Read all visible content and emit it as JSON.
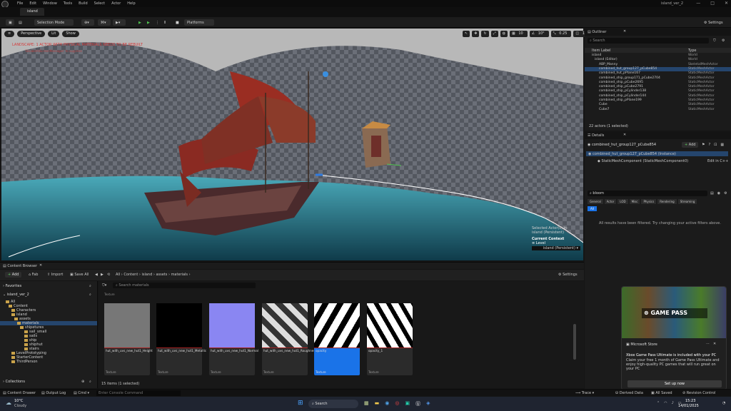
{
  "titlebar": {
    "menus": [
      "File",
      "Edit",
      "Window",
      "Tools",
      "Build",
      "Select",
      "Actor",
      "Help"
    ],
    "window_title": "island_ver_2",
    "controls": [
      "—",
      "□",
      "✕"
    ]
  },
  "tab": {
    "label": "island"
  },
  "toolbar": {
    "selection_mode": "Selection Mode",
    "platforms": "Platforms",
    "settings": "Settings"
  },
  "viewport": {
    "perspective": "Perspective",
    "lit": "Lit",
    "show": "Show",
    "warning": "LANDSCAPE: 1 ACTOR WITH PHYSICAL MATERIALS NEEDS TO BE REBUILT",
    "warning2": "'DisableAllScreenMessages' to suppress",
    "right_vals": [
      "10",
      "10°",
      "0.25",
      "1"
    ],
    "selected_actors": "Selected Actor(s) in:",
    "level_name": "island (Persistent)",
    "current_context": "Current Context",
    "level_label": "Level",
    "level_value": "island (Persistent)"
  },
  "content_browser": {
    "title": "Content Browser",
    "add": "Add",
    "fab": "Fab",
    "import": "Import",
    "save_all": "Save All",
    "breadcrumb": [
      "All",
      "Content",
      "island",
      "assets",
      "materials"
    ],
    "settings": "Settings",
    "favorites": "Favorites",
    "project": "island_ver_2",
    "search_placeholder": "Search materials",
    "collections": "Collections",
    "count": "15 items (1 selected)",
    "header_type": "Texture",
    "tree": [
      "All",
      "Content",
      "Characters",
      "island",
      "assets",
      "materials",
      "shipetures",
      "sail_small",
      "sails",
      "ship",
      "shiphut",
      "stairs",
      "LevelPrototyping",
      "StarterContent",
      "ThirdPerson"
    ],
    "assets": [
      {
        "name": "hut_with_uvs_new_hut1_Height",
        "type": "Texture"
      },
      {
        "name": "hut_with_uvs_new_hut1_Metallic",
        "type": "Texture"
      },
      {
        "name": "hut_with_uvs_new_hut1_Normal",
        "type": "Texture"
      },
      {
        "name": "hut_with_uvs_new_hut1_Roughness",
        "type": "Texture"
      },
      {
        "name": "opacity",
        "type": "Texture"
      },
      {
        "name": "opacity_1",
        "type": "Texture"
      }
    ]
  },
  "bottom": {
    "content_drawer": "Content Drawer",
    "output_log": "Output Log",
    "cmd": "Cmd",
    "console_placeholder": "Enter Console Command",
    "trace": "Trace",
    "derived_data": "Derived Data",
    "all_saved": "All Saved",
    "revision_control": "Revision Control"
  },
  "outliner": {
    "title": "Outliner",
    "search_placeholder": "Search",
    "col_label": "Item Label",
    "col_type": "Type",
    "summary": "22 actors (1 selected)",
    "rows": [
      {
        "label": "island",
        "type": "World"
      },
      {
        "label": "island (Editor)",
        "type": "World"
      },
      {
        "label": "ABP_Manny",
        "type": "SkeletalMeshActor"
      },
      {
        "label": "combined_hut_group127_pCube854",
        "type": "StaticMeshActor"
      },
      {
        "label": "combined_hut_pPlane167",
        "type": "StaticMeshActor"
      },
      {
        "label": "combined_ship_group171_pCube2704",
        "type": "StaticMeshActor"
      },
      {
        "label": "combined_ship_pCube2695",
        "type": "StaticMeshActor"
      },
      {
        "label": "combined_ship_pCube2791",
        "type": "StaticMeshActor"
      },
      {
        "label": "combined_ship_pCylinder138",
        "type": "StaticMeshActor"
      },
      {
        "label": "combined_ship_pCylinder144",
        "type": "StaticMeshActor"
      },
      {
        "label": "combined_ship_pPlane199",
        "type": "StaticMeshActor"
      },
      {
        "label": "Cube",
        "type": "StaticMeshActor"
      },
      {
        "label": "Cube7",
        "type": "StaticMeshActor"
      }
    ]
  },
  "details": {
    "title": "Details",
    "actor": "combined_hut_group127_pCube854",
    "add": "Add",
    "instance": "combined_hut_group127_pCube854 (Instance)",
    "component": "StaticMeshComponent (StaticMeshComponent0)",
    "edit_cpp": "Edit in C++",
    "search_value": "bloom",
    "filters": [
      "General",
      "Actor",
      "LOD",
      "Misc",
      "Physics",
      "Rendering",
      "Streaming"
    ],
    "all": "All",
    "empty_msg": "All results have been filtered. Try changing your active filters above."
  },
  "toast": {
    "banner_text": "GAME PASS",
    "source": "Microsoft Store",
    "title": "Xbox Game Pass Ultimate is included with your PC",
    "body": "Claim your free 1 month of Game Pass Ultimate and enjoy high-quality PC games that will run great on your PC",
    "button": "Set up now"
  },
  "taskbar": {
    "temp": "10°C",
    "weather": "Cloudy",
    "search": "Search",
    "time": "15:23",
    "date": "14/01/2025"
  }
}
